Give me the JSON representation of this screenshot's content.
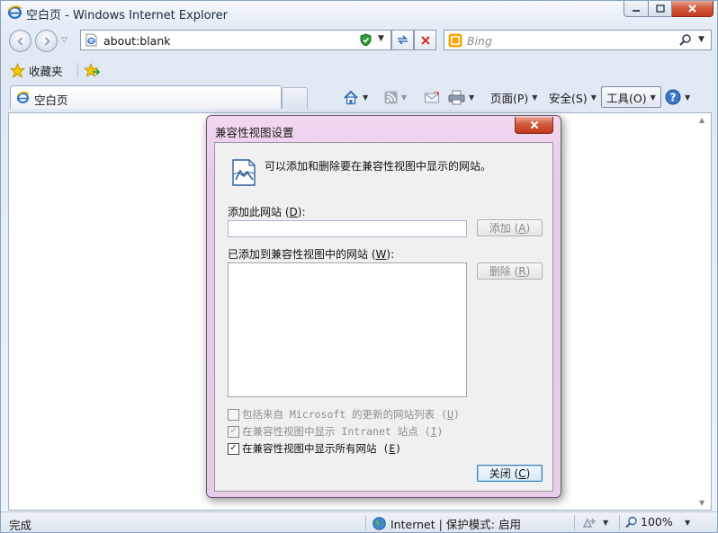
{
  "window": {
    "title": "空白页 - Windows Internet Explorer"
  },
  "address_bar": {
    "url": "about:blank"
  },
  "search": {
    "placeholder": "Bing"
  },
  "favorites": {
    "label": "收藏夹"
  },
  "tabs": [
    {
      "label": "空白页"
    }
  ],
  "command_bar": {
    "page": "页面(P)",
    "safety": "安全(S)",
    "tools": "工具(O)"
  },
  "status_bar": {
    "status": "完成",
    "zone": "Internet | 保护模式: 启用",
    "zoom": "100%"
  },
  "dialog": {
    "title": "兼容性视图设置",
    "intro": "可以添加和删除要在兼容性视图中显示的网站。",
    "add_site_label": "添加此网站",
    "add_site_key": "D",
    "add_site_value": "",
    "added_sites_label": "已添加到兼容性视图中的网站",
    "added_sites_key": "W",
    "added_sites": [],
    "add_button": "添加",
    "add_button_key": "A",
    "remove_button": "删除",
    "remove_button_key": "R",
    "close_button": "关闭",
    "close_button_key": "C",
    "checkboxes": [
      {
        "label": "包括来自 Microsoft 的更新的网站列表",
        "key": "U",
        "checked": false,
        "enabled": false
      },
      {
        "label": "在兼容性视图中显示 Intranet 站点",
        "key": "I",
        "checked": true,
        "enabled": false
      },
      {
        "label": "在兼容性视图中显示所有网站",
        "key": "E",
        "checked": true,
        "enabled": true
      }
    ]
  },
  "colors": {
    "dialog_frame": "#e9c9e8",
    "close_red": "#c23b1f",
    "ie_blue": "#2a6fc9"
  }
}
